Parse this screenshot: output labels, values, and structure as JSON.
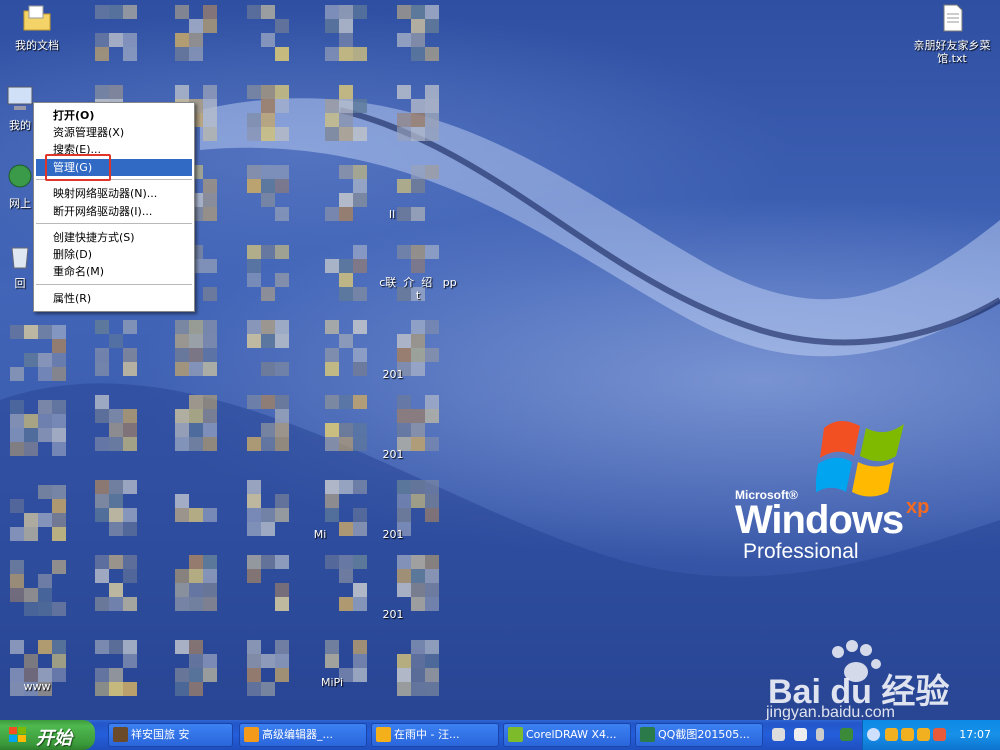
{
  "desktop": {
    "icons": [
      {
        "name": "my-documents-icon",
        "label": "我的文档"
      },
      {
        "name": "my-computer-icon",
        "label": "我的"
      },
      {
        "name": "network-icon",
        "label": "网上"
      },
      {
        "name": "recycle-bin-icon",
        "label": "回"
      },
      {
        "name": "text-file-icon",
        "label": "亲朋好友家乡菜馆.txt"
      }
    ],
    "partial_labels": [
      "c联  介  绍   ppt",
      "Il",
      "Mi",
      "MiPi",
      "201",
      "201",
      "201",
      "201",
      "www"
    ]
  },
  "context_menu": {
    "items": [
      {
        "label": "打开(O)",
        "bold": true
      },
      {
        "label": "资源管理器(X)"
      },
      {
        "label": "搜索(E)..."
      },
      {
        "label": "管理(G)",
        "selected": true
      },
      {
        "label": "映射网络驱动器(N)..."
      },
      {
        "label": "断开网络驱动器(I)..."
      },
      {
        "label": "创建快捷方式(S)"
      },
      {
        "label": "删除(D)"
      },
      {
        "label": "重命名(M)"
      },
      {
        "label": "属性(R)"
      }
    ]
  },
  "branding": {
    "microsoft": "Microsoft®",
    "windows": "Windows",
    "xp": "xp",
    "edition": "Professional"
  },
  "watermark": {
    "logo_text": "Bai du 经验",
    "url": "jingyan.baidu.com"
  },
  "taskbar": {
    "start_label": "开始",
    "tasks": [
      {
        "label": "祥安国旅 安",
        "icon_color": "#6b4a2a"
      },
      {
        "label": "高级编辑器_...",
        "icon_color": "#f39a1a"
      },
      {
        "label": "在雨中 - 汪...",
        "icon_color": "#f3b01a"
      },
      {
        "label": "CorelDRAW X4...",
        "icon_color": "#7dbb2a"
      },
      {
        "label": "QQ截图201505...",
        "icon_color": "#2a7a4a"
      }
    ],
    "clock": "17:07"
  },
  "colors": {
    "selection": "#316ac5",
    "highlight_box": "#e0352b",
    "taskbar": "#245edb",
    "start": "#3c9a3c"
  }
}
